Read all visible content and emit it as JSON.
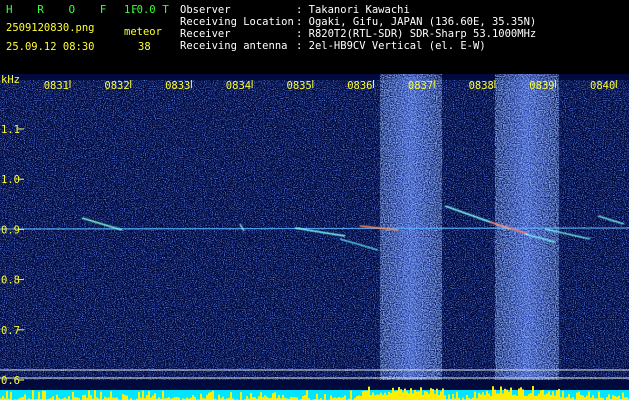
{
  "app": {
    "title": "H R O F F T",
    "version": "1.0.0",
    "filename": "2509120830.png",
    "mode_label": "meteor",
    "datetime": "25.09.12 08:30",
    "count": "38"
  },
  "info": [
    {
      "label": "Observer",
      "value": ": Takanori Kawachi"
    },
    {
      "label": "Receiving Location",
      "value": ": Ogaki, Gifu, JAPAN (136.60E, 35.35N)"
    },
    {
      "label": "Receiver",
      "value": ": R820T2(RTL-SDR) SDR-Sharp 53.1000MHz"
    },
    {
      "label": "Receiving antenna",
      "value": ": 2el-HB9CV Vertical (el. E-W)"
    }
  ],
  "colors": {
    "background": "#000000",
    "spectrum_base": "#000a3c",
    "noise": "#1e3cff",
    "header_green": "#33ff33",
    "header_yellow": "#ffff33",
    "bar_cyan": "#00e5ff",
    "bar_yellow": "#ffee00"
  },
  "chart_data": {
    "type": "heatmap",
    "ylabel": "kHz",
    "x_ticks": [
      "0831",
      "0832",
      "0833",
      "0834",
      "0835",
      "0836",
      "0837",
      "0838",
      "0839",
      "0840"
    ],
    "y_ticks": [
      "1.1",
      "1.0",
      "0.9",
      "0.8",
      "0.7",
      "0.6"
    ],
    "ylim": [
      0.58,
      1.18
    ],
    "grid": false
  }
}
